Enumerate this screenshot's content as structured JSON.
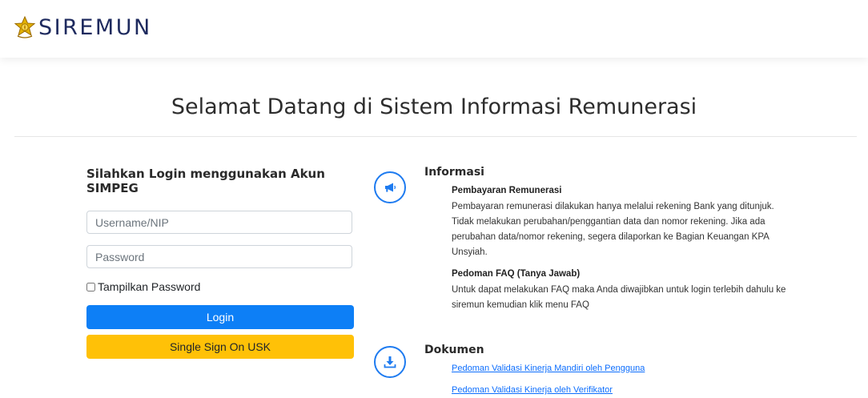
{
  "brand": {
    "name": "SIREMUN",
    "logo_icon": "university-emblem-icon",
    "accent_color": "#1e2a5e"
  },
  "welcome_title": "Selamat Datang di Sistem Informasi Remunerasi",
  "login": {
    "heading": "Silahkan Login menggunakan Akun SIMPEG",
    "username_placeholder": "Username/NIP",
    "password_placeholder": "Password",
    "show_password_label": "Tampilkan Password",
    "login_button": "Login",
    "sso_button": "Single Sign On USK",
    "login_color": "#0d7ff6",
    "sso_color": "#ffc107"
  },
  "info": {
    "icon": "megaphone-icon",
    "title": "Informasi",
    "items": [
      {
        "title": "Pembayaran Remunerasi",
        "body": "Pembayaran remunerasi dilakukan hanya melalui rekening Bank yang ditunjuk. Tidak melakukan perubahan/penggantian data dan nomor rekening. Jika ada perubahan data/nomor rekening, segera dilaporkan ke Bagian Keuangan KPA Unsyiah."
      },
      {
        "title": "Pedoman FAQ (Tanya Jawab)",
        "body": "Untuk dapat melakukan FAQ maka Anda diwajibkan untuk login terlebih dahulu ke siremun kemudian klik menu FAQ"
      }
    ]
  },
  "documents": {
    "icon": "download-icon",
    "title": "Dokumen",
    "links": [
      "Pedoman Validasi Kinerja Mandiri oleh Pengguna",
      "Pedoman Validasi Kinerja oleh Verifikator"
    ]
  }
}
